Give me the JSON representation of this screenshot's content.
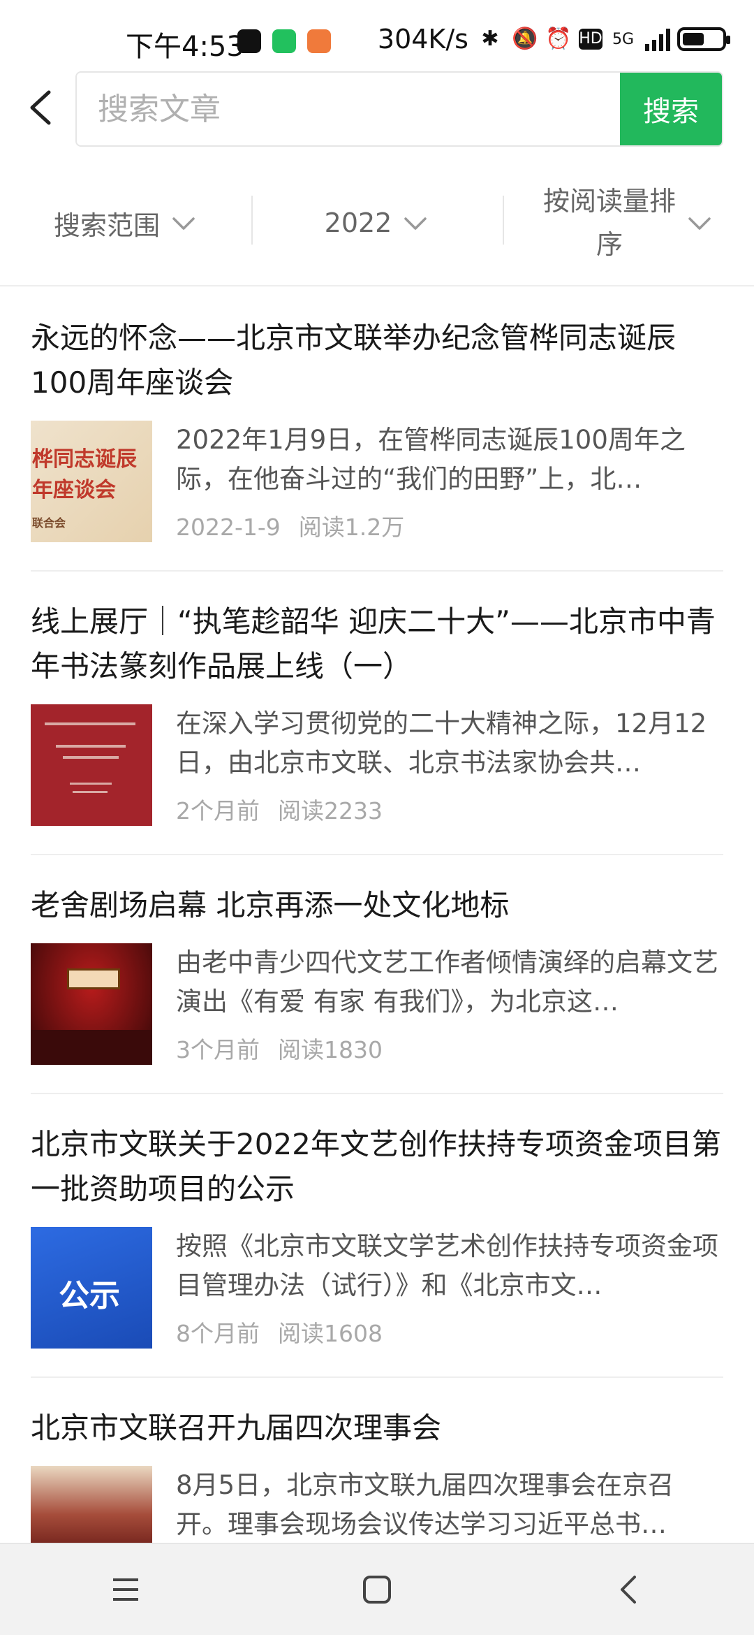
{
  "status_bar": {
    "time": "下午4:53",
    "network_speed": "304K/s",
    "network_type": "5G",
    "icons": [
      "tiktok-icon",
      "wechat-icon",
      "weibo-icon",
      "bluetooth-icon",
      "mute-icon",
      "alarm-icon",
      "hd-icon",
      "signal-icon",
      "battery-icon"
    ]
  },
  "search": {
    "placeholder": "搜索文章",
    "button_label": "搜索"
  },
  "filters": [
    {
      "label": "搜索范围"
    },
    {
      "label": "2022"
    },
    {
      "label": "按阅读量排序"
    }
  ],
  "articles": [
    {
      "title": "永远的怀念——北京市文联举办纪念管桦同志诞辰100周年座谈会",
      "snippet": "2022年1月9日，在管桦同志诞辰100周年之际，在他奋斗过的“我们的田野”上，北…",
      "date": "2022-1-9",
      "reads": "阅读1.2万",
      "thumb_text_1": "桦同志诞辰",
      "thumb_text_2": "年座谈会",
      "thumb_text_3": "联合会"
    },
    {
      "title": "线上展厅｜“执笔趁韶华 迎庆二十大”——北京市中青年书法篆刻作品展上线（一）",
      "snippet": "在深入学习贯彻党的二十大精神之际，12月12日，由北京市文联、北京书法家协会共…",
      "date": "2个月前",
      "reads": "阅读2233"
    },
    {
      "title": "老舍剧场启幕 北京再添一处文化地标",
      "snippet": "由老中青少四代文艺工作者倾情演绎的启幕文艺演出《有爱 有家 有我们》，为北京这…",
      "date": "3个月前",
      "reads": "阅读1830"
    },
    {
      "title": "北京市文联关于2022年文艺创作扶持专项资金项目第一批资助项目的公示",
      "snippet": "按照《北京市文联文学艺术创作扶持专项资金项目管理办法（试行）》和《北京市文…",
      "date": "8个月前",
      "reads": "阅读1608",
      "thumb_text": "公示"
    },
    {
      "title": "北京市文联召开九届四次理事会",
      "snippet": "8月5日，北京市文联九届四次理事会在京召开。理事会现场会议传达学习习近平总书…",
      "date": "",
      "reads": ""
    }
  ],
  "colors": {
    "accent": "#22b85c",
    "meta_text": "#a8a8a8"
  }
}
